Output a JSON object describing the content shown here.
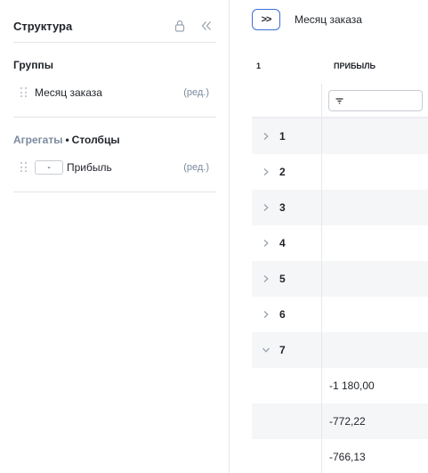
{
  "panel": {
    "title": "Структура",
    "groups_title": "Группы",
    "groups": [
      {
        "label": "Месяц заказа",
        "edit_label": "(ред.)"
      }
    ],
    "aggregates_title_muted": "Агрегаты",
    "aggregates_sep": "•",
    "aggregates_title_bold": "Столбцы",
    "aggregates": [
      {
        "agg": "-",
        "label": "Прибыль",
        "edit_label": "(ред.)"
      }
    ]
  },
  "toolbar": {
    "expand_button": ">>",
    "breadcrumb": "Месяц заказа"
  },
  "grid": {
    "col1_header": "1",
    "col2_header": "ПРИБЫЛЬ",
    "filter_icon": "filter-icon",
    "rows": [
      {
        "group": "1",
        "expanded": false,
        "value": ""
      },
      {
        "group": "2",
        "expanded": false,
        "value": ""
      },
      {
        "group": "3",
        "expanded": false,
        "value": ""
      },
      {
        "group": "4",
        "expanded": false,
        "value": ""
      },
      {
        "group": "5",
        "expanded": false,
        "value": ""
      },
      {
        "group": "6",
        "expanded": false,
        "value": ""
      },
      {
        "group": "7",
        "expanded": true,
        "value": ""
      },
      {
        "group": "",
        "expanded": null,
        "value": "-1 180,00"
      },
      {
        "group": "",
        "expanded": null,
        "value": "-772,22"
      },
      {
        "group": "",
        "expanded": null,
        "value": "-766,13"
      }
    ]
  },
  "colors": {
    "accent": "#3b6fd8",
    "text": "#1f2329",
    "muted": "#7b8a9e",
    "row_alt": "#f5f6f8"
  }
}
